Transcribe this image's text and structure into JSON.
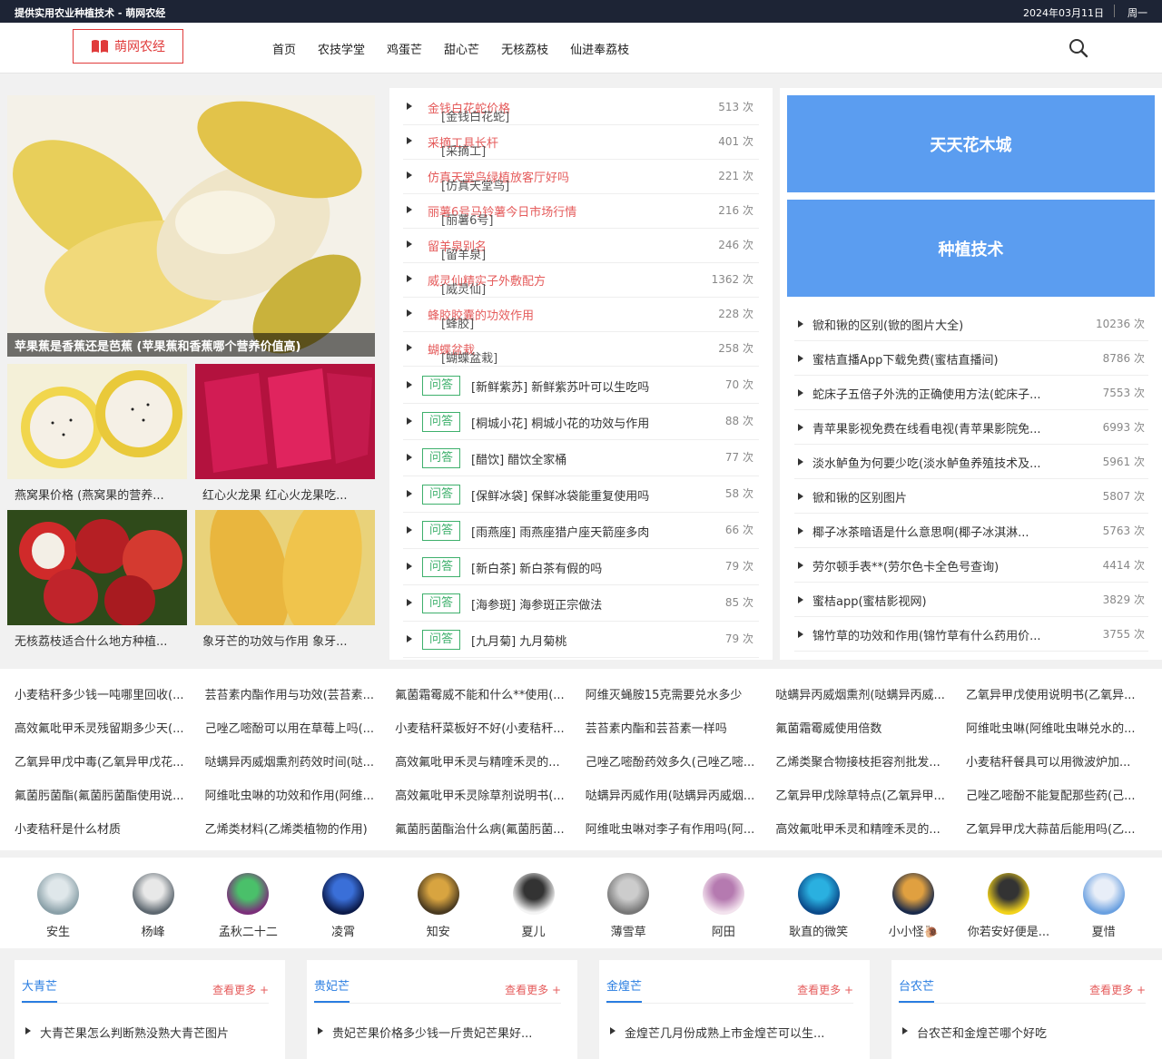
{
  "topbar": {
    "site_line": "提供实用农业种植技术 - 萌网农经",
    "date": "2024年03月11日",
    "weekday": "周一"
  },
  "header": {
    "logo": "萌网农经",
    "nav": [
      "首页",
      "农技学堂",
      "鸡蛋芒",
      "甜心芒",
      "无核荔枝",
      "仙进奉荔枝"
    ]
  },
  "colors": {
    "accent_red": "#e55b5b",
    "accent_blue": "#5b9df0",
    "accent_green": "#3eb06c",
    "topbar_bg": "#1d2435"
  },
  "icons": {
    "logo": "book-icon",
    "search": "search-icon",
    "list_bullet": "triangle-right-icon"
  },
  "featured": {
    "main_caption": "苹果蕉是香蕉还是芭蕉 (苹果蕉和香蕉哪个营养价值高)",
    "thumbs": [
      {
        "caption": "燕窝果价格 (燕窝果的营养..."
      },
      {
        "caption": "红心火龙果 红心火龙果吃..."
      },
      {
        "caption": "无核荔枝适合什么地方种植..."
      },
      {
        "caption": "象牙芒的功效与作用 象牙..."
      }
    ]
  },
  "middle_list": {
    "articles": [
      {
        "tag": "[金钱白花蛇]",
        "title": "金钱白花蛇价格",
        "count": "513 次"
      },
      {
        "tag": "[采摘工]",
        "title": "采摘工具长杆",
        "count": "401 次"
      },
      {
        "tag": "[仿真天堂鸟]",
        "title": "仿真天堂鸟绿植放客厅好吗",
        "count": "221 次"
      },
      {
        "tag": "[丽薯6号]",
        "title": "丽薯6号马铃薯今日市场行情",
        "count": "216 次"
      },
      {
        "tag": "[留羊泉]",
        "title": "留羊泉别名",
        "count": "246 次"
      },
      {
        "tag": "[威灵仙]",
        "title": "威灵仙精实子外敷配方",
        "count": "1362 次"
      },
      {
        "tag": "[蜂胶]",
        "title": "蜂胶胶囊的功效作用",
        "count": "228 次"
      },
      {
        "tag": "[蝴蝶盆栽]",
        "title": "蝴蝶盆栽",
        "count": "258 次"
      }
    ],
    "qa_badge": "问答",
    "questions": [
      {
        "text": "[新鲜紫苏]  新鲜紫苏叶可以生吃吗",
        "count": "70 次"
      },
      {
        "text": "[桐城小花]  桐城小花的功效与作用",
        "count": "88 次"
      },
      {
        "text": "[醋饮]  醋饮全家桶",
        "count": "77 次"
      },
      {
        "text": "[保鲜冰袋]  保鲜冰袋能重复使用吗",
        "count": "58 次"
      },
      {
        "text": "[雨燕座]  雨燕座猎户座天箭座多肉",
        "count": "66 次"
      },
      {
        "text": "[新白茶]  新白茶有假的吗",
        "count": "79 次"
      },
      {
        "text": "[海参斑]  海参斑正宗做法",
        "count": "85 次"
      },
      {
        "text": "[九月菊]  九月菊桃",
        "count": "79 次"
      }
    ]
  },
  "right": {
    "box1": "天天花木城",
    "box2": "种植技术",
    "list": [
      {
        "title": "锨和锹的区别(锨的图片大全)",
        "count": "10236 次"
      },
      {
        "title": "蜜桔直播App下载免费(蜜桔直播间)",
        "count": "8786 次"
      },
      {
        "title": "蛇床子五倍子外洗的正确使用方法(蛇床子...",
        "count": "7553 次"
      },
      {
        "title": "青苹果影视免费在线看电视(青苹果影院免...",
        "count": "6993 次"
      },
      {
        "title": "淡水鲈鱼为何要少吃(淡水鲈鱼养殖技术及...",
        "count": "5961 次"
      },
      {
        "title": "锨和锹的区别图片",
        "count": "5807 次"
      },
      {
        "title": "椰子冰茶暗语是什么意思啊(椰子冰淇淋...",
        "count": "5763 次"
      },
      {
        "title": "劳尔顿手表**(劳尔色卡全色号查询)",
        "count": "4414 次"
      },
      {
        "title": "蜜桔app(蜜桔影视网)",
        "count": "3829 次"
      },
      {
        "title": "锦竹草的功效和作用(锦竹草有什么药用价...",
        "count": "3755 次"
      }
    ]
  },
  "tag_grid": [
    [
      "小麦秸秆多少钱一吨哪里回收(...",
      "芸苔素内酯作用与功效(芸苔素...",
      "氟菌霜霉威不能和什么**使用(...",
      "阿维灭蝇胺15克需要兑水多少",
      "哒螨异丙威烟熏剂(哒螨异丙威...",
      "乙氧异甲戊使用说明书(乙氧异..."
    ],
    [
      "高效氟吡甲禾灵残留期多少天(...",
      "己唑乙嘧酚可以用在草莓上吗(...",
      "小麦秸秆菜板好不好(小麦秸秆...",
      "芸苔素内酯和芸苔素一样吗",
      "氟菌霜霉威使用倍数",
      "阿维吡虫啉(阿维吡虫啉兑水的..."
    ],
    [
      "乙氧异甲戊中毒(乙氧异甲戊花...",
      "哒螨异丙威烟熏剂药效时间(哒...",
      "高效氟吡甲禾灵与精喹禾灵的...",
      "己唑乙嘧酚药效多久(己唑乙嘧...",
      "乙烯类聚合物接枝拒容剂批发...",
      "小麦秸秆餐具可以用微波炉加..."
    ],
    [
      "氟菌肟菌酯(氟菌肟菌酯使用说...",
      "阿维吡虫啉的功效和作用(阿维...",
      "高效氟吡甲禾灵除草剂说明书(...",
      "哒螨异丙威作用(哒螨异丙威烟...",
      "乙氧异甲戊除草特点(乙氧异甲...",
      "己唑乙嘧酚不能复配那些药(己..."
    ],
    [
      "小麦秸秆是什么材质",
      "乙烯类材料(乙烯类植物的作用)",
      "氟菌肟菌酯治什么病(氟菌肟菌...",
      "阿维吡虫啉对李子有作用吗(阿...",
      "高效氟吡甲禾灵和精喹禾灵的...",
      "乙氧异甲戊大蒜苗后能用吗(乙..."
    ]
  ],
  "users": [
    "安生",
    "杨峰",
    "孟秋二十二",
    "凌霄",
    "知安",
    "夏儿",
    "薄雪草",
    "阿田",
    "耿直的微笑",
    "小小怪🐌",
    "你若安好便是...",
    "夏惜"
  ],
  "categories": [
    {
      "title": "大青芒",
      "more": "查看更多 +",
      "item": "大青芒果怎么判断熟没熟大青芒图片"
    },
    {
      "title": "贵妃芒",
      "more": "查看更多 +",
      "item": "贵妃芒果价格多少钱一斤贵妃芒果好..."
    },
    {
      "title": "金煌芒",
      "more": "查看更多 +",
      "item": "金煌芒几月份成熟上市金煌芒可以生..."
    },
    {
      "title": "台农芒",
      "more": "查看更多 +",
      "item": "台农芒和金煌芒哪个好吃"
    }
  ]
}
